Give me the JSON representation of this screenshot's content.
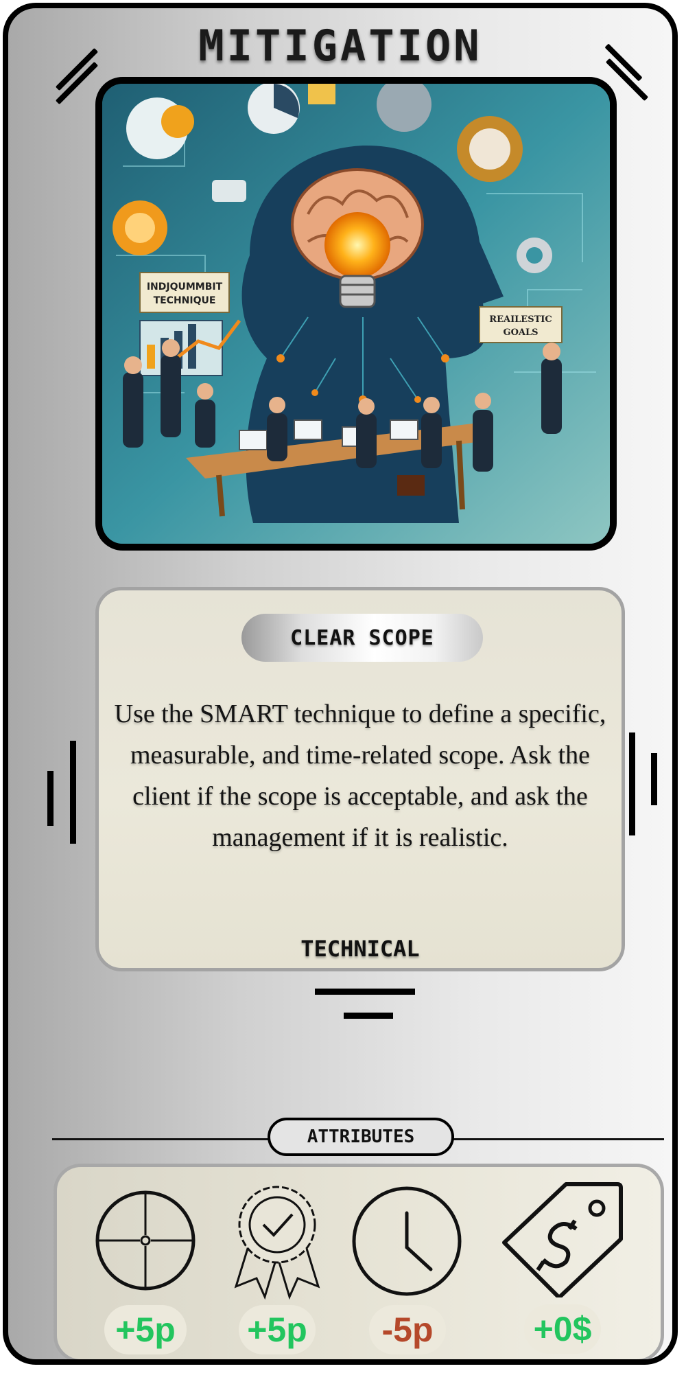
{
  "card": {
    "title": "MITIGATION",
    "illustration": {
      "sign_left": [
        "INDJQUMMBIT",
        "TECHNIQUE"
      ],
      "sign_right": [
        "REAILESTIC",
        "GOALS"
      ]
    },
    "name": "CLEAR SCOPE",
    "description": "Use the SMART technique to define a specific, measurable, and time-related scope. Ask the client if the scope is acceptable, and ask the management if it is realistic.",
    "category": "TECHNICAL",
    "attributes_label": "ATTRIBUTES",
    "attributes": [
      {
        "icon": "target-icon",
        "value": "+5p",
        "color": "#22c55e"
      },
      {
        "icon": "quality-badge-icon",
        "value": "+5p",
        "color": "#22c55e"
      },
      {
        "icon": "clock-icon",
        "value": "-5p",
        "color": "#b5482a"
      },
      {
        "icon": "price-tag-icon",
        "value": "+0$",
        "color": "#22c55e"
      }
    ]
  }
}
